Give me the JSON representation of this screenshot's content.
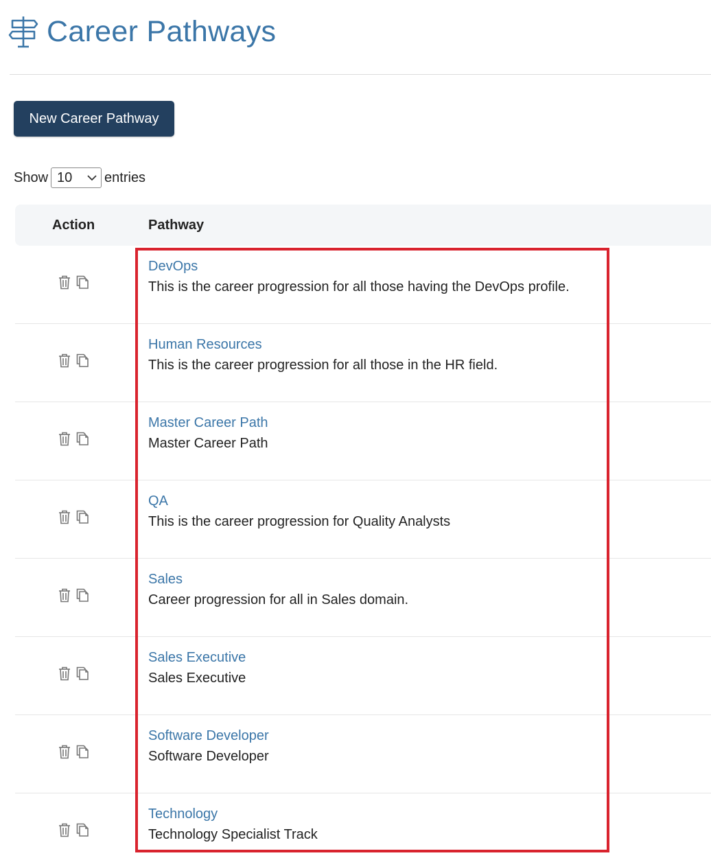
{
  "header": {
    "title": "Career Pathways",
    "icon": "signpost-icon",
    "accent_color": "#3b76a8"
  },
  "toolbar": {
    "new_button_label": "New Career Pathway",
    "button_color": "#23405f"
  },
  "length_menu": {
    "show_label": "Show",
    "selected": "10",
    "entries_label": "entries"
  },
  "table": {
    "columns": [
      "Action",
      "Pathway"
    ],
    "rows": [
      {
        "name": "DevOps",
        "description": "This is the career progression for all those having the DevOps profile."
      },
      {
        "name": "Human Resources",
        "description": "This is the career progression for all those in the HR field."
      },
      {
        "name": "Master Career Path",
        "description": "Master Career Path"
      },
      {
        "name": "QA",
        "description": "This is the career progression for Quality Analysts"
      },
      {
        "name": "Sales",
        "description": "Career progression for all in Sales domain."
      },
      {
        "name": "Sales Executive",
        "description": "Sales Executive"
      },
      {
        "name": "Software Developer",
        "description": "Software Developer"
      },
      {
        "name": "Technology",
        "description": "Technology Specialist Track"
      }
    ],
    "row_action_icons": [
      "trash-icon",
      "copy-icon"
    ]
  },
  "highlight_color": "#d9232e"
}
